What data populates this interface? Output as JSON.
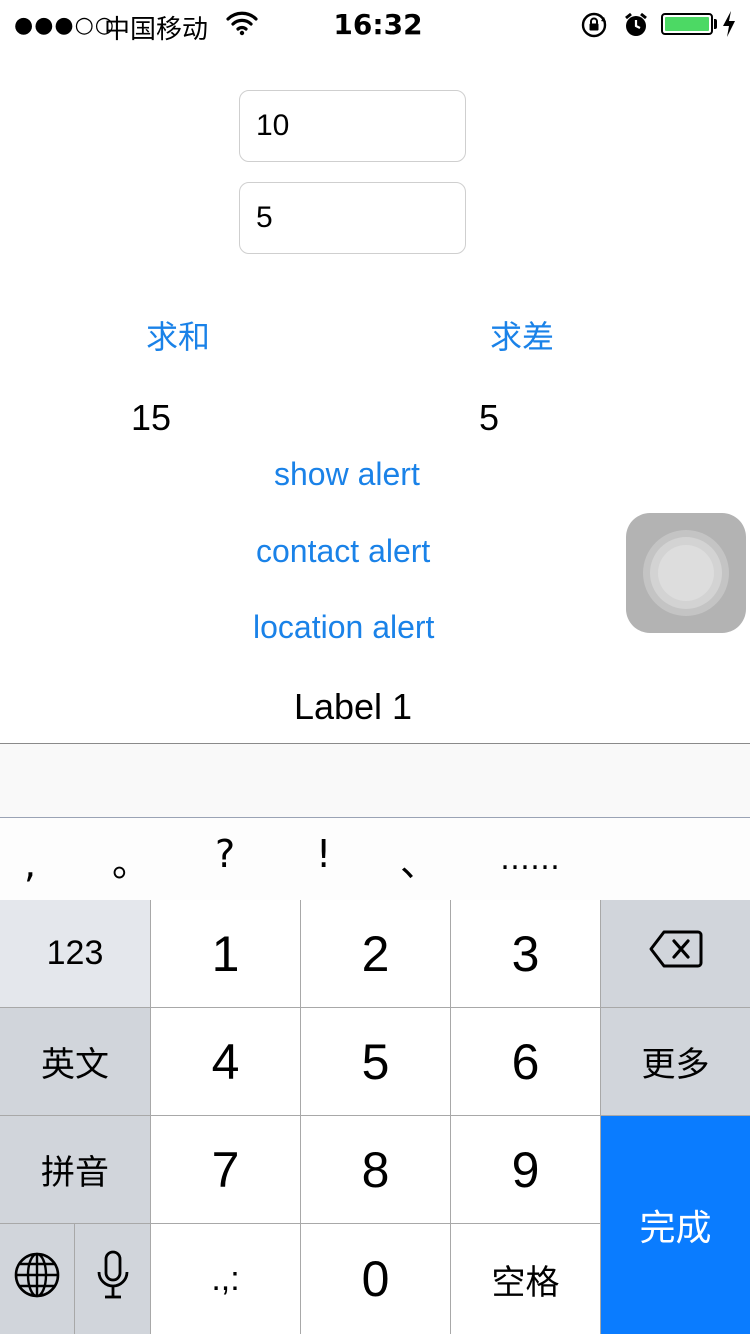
{
  "status_bar": {
    "signal": "●●●○○",
    "carrier": "中国移动",
    "time": "16:32",
    "battery_color": "#4cd964"
  },
  "form": {
    "field1_value": "10",
    "field2_value": "5"
  },
  "buttons": {
    "sum": "求和",
    "diff": "求差",
    "show_alert": "show alert",
    "contact_alert": "contact alert",
    "location_alert": "location alert"
  },
  "results": {
    "sum": "15",
    "diff": "5"
  },
  "label1": "Label 1",
  "keyboard": {
    "punctuation": [
      ",",
      "。",
      "?",
      "!",
      "、",
      "……"
    ],
    "mode_123": "123",
    "english": "英文",
    "pinyin": "拼音",
    "more": "更多",
    "space": "空格",
    "punct_key": ".,:",
    "done": "完成",
    "digits": [
      "1",
      "2",
      "3",
      "4",
      "5",
      "6",
      "7",
      "8",
      "9",
      "0"
    ]
  },
  "colors": {
    "accent": "#1a82e8",
    "done_key": "#0a7cff"
  }
}
